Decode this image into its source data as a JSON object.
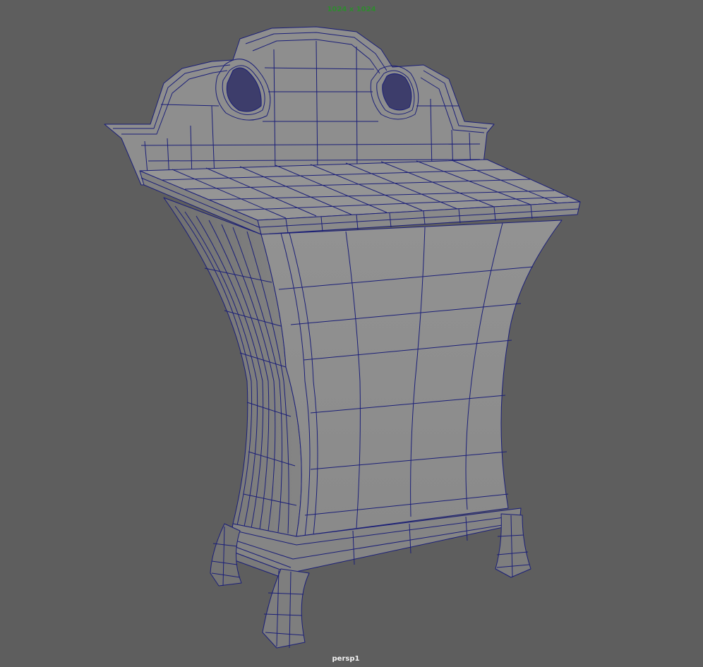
{
  "viewport": {
    "resolution_gate": "1024 x 1024",
    "camera_name": "persp1"
  },
  "colors": {
    "background": "#5e5e5e",
    "mesh_fill": "#8c8c8c",
    "mesh_fill_light": "#959595",
    "mesh_fill_dark": "#747474",
    "wireframe": "#1b1f78",
    "resolution_text": "#2f8a2f",
    "camera_text": "#f2f2f2"
  },
  "mesh": {
    "display_mode": "shaded-with-wireframe",
    "object": "cabinet-with-crested-backsplash"
  }
}
